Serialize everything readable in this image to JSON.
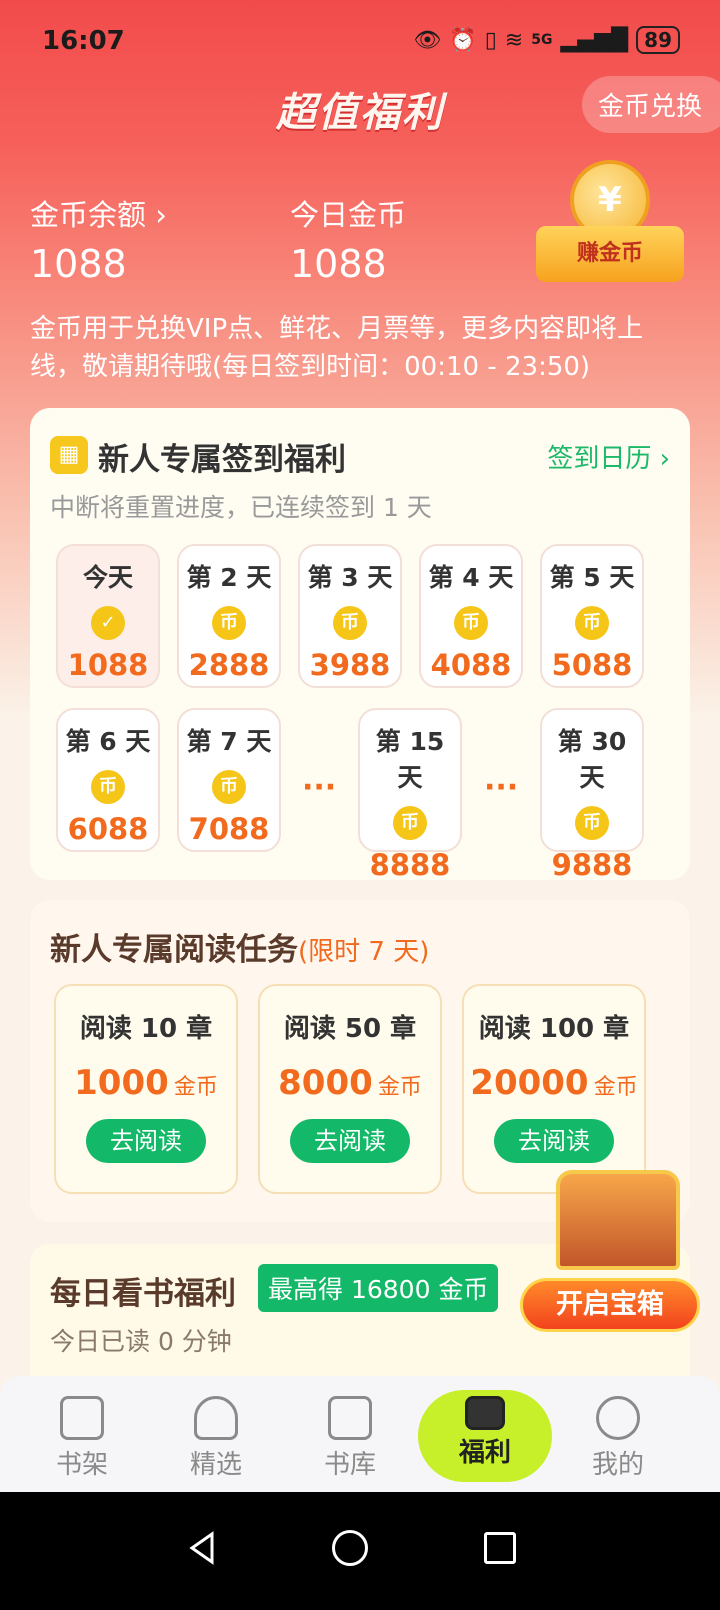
{
  "status_bar": {
    "time": "16:07",
    "battery": "89",
    "network": "5G"
  },
  "header": {
    "title": "超值福利",
    "exchange_button": "金币兑换"
  },
  "stats": {
    "balance_label": "金币余额 ›",
    "balance_value": "1088",
    "today_label": "今日金币",
    "today_value": "1088",
    "earn_button": "赚金币",
    "earn_coin_symbol": "¥"
  },
  "description": "金币用于兑换VIP点、鲜花、月票等，更多内容即将上线，敬请期待哦(每日签到时间：00:10 - 23:50)",
  "signin": {
    "title": "新人专属签到福利",
    "calendar_link": "签到日历 ›",
    "subtitle": "中断将重置进度，已连续签到 1 天",
    "coin_symbol": "币",
    "check_symbol": "✓",
    "dots": "···",
    "days": [
      {
        "label": "今天",
        "value": "1088",
        "checked": true
      },
      {
        "label": "第 2 天",
        "value": "2888"
      },
      {
        "label": "第 3 天",
        "value": "3988"
      },
      {
        "label": "第 4 天",
        "value": "4088"
      },
      {
        "label": "第 5 天",
        "value": "5088"
      },
      {
        "label": "第 6 天",
        "value": "6088"
      },
      {
        "label": "第 7 天",
        "value": "7088"
      },
      {
        "label": "第 15 天",
        "value": "8888"
      },
      {
        "label": "第 30 天",
        "value": "9888"
      }
    ]
  },
  "reading": {
    "title": "新人专属阅读任务",
    "limit": "(限时 7 天)",
    "unit": "金币",
    "button": "去阅读",
    "tasks": [
      {
        "label": "阅读 10 章",
        "value": "1000"
      },
      {
        "label": "阅读 50 章",
        "value": "8000"
      },
      {
        "label": "阅读 100 章",
        "value": "20000"
      }
    ]
  },
  "daily": {
    "title": "每日看书福利",
    "badge": "最高得 16800 金币",
    "subtitle": "今日已读 0 分钟"
  },
  "treasure": {
    "button": "开启宝箱"
  },
  "tabs": [
    {
      "label": "书架",
      "icon": "book-open-icon"
    },
    {
      "label": "精选",
      "icon": "thumbs-up-icon"
    },
    {
      "label": "书库",
      "icon": "bookmark-icon"
    },
    {
      "label": "福利",
      "icon": "gift-icon",
      "active": true
    },
    {
      "label": "我的",
      "icon": "user-icon"
    }
  ],
  "colors": {
    "hero": "#f24b4c",
    "accent_green": "#13b968",
    "accent_orange": "#f16a1d",
    "active_tab": "#c7ef2a"
  }
}
